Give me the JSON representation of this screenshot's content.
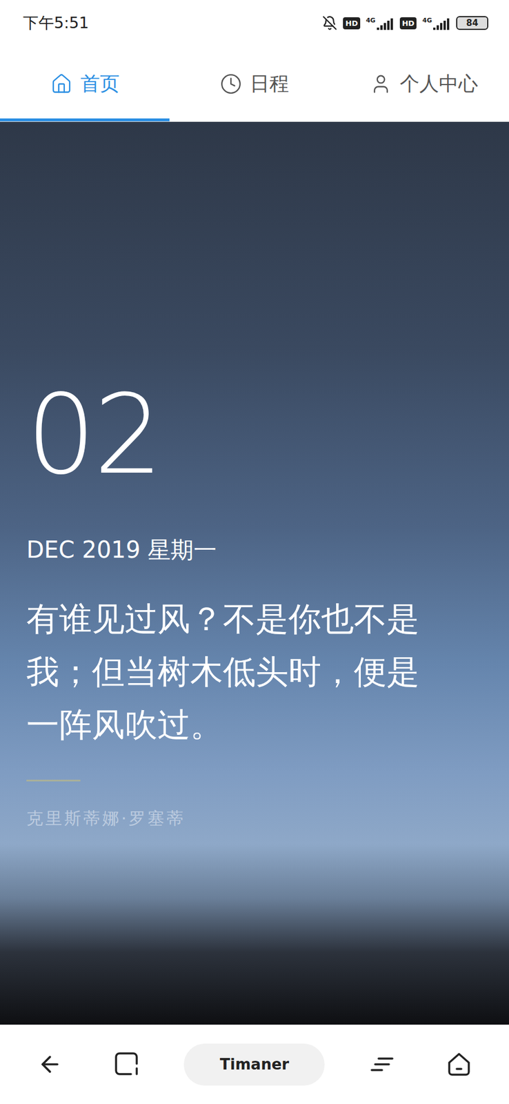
{
  "status_bar": {
    "time": "下午5:51",
    "network_badges": [
      "HD",
      "HD"
    ],
    "network_type": "4G",
    "battery": "84"
  },
  "tabs": [
    {
      "label": "首页",
      "selected": true
    },
    {
      "label": "日程",
      "selected": false
    },
    {
      "label": "个人中心",
      "selected": false
    }
  ],
  "hero": {
    "day": "02",
    "date_line": "DEC 2019 星期一",
    "quote": "有谁见过风？不是你也不是我；但当树木低头时，便是一阵风吹过。",
    "author": "克里斯蒂娜·罗塞蒂"
  },
  "nav_bar": {
    "app_label": "Timaner"
  }
}
